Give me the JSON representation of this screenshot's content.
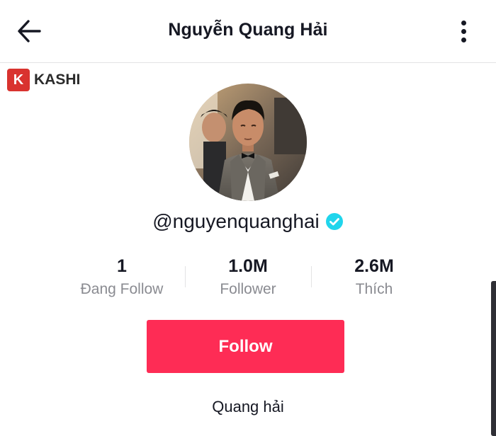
{
  "header": {
    "title": "Nguyễn Quang Hải",
    "back_icon": "arrow-left-icon",
    "more_icon": "more-vertical-icon"
  },
  "watermark": {
    "logo_letter": "K",
    "text": "KASHI"
  },
  "profile": {
    "username": "@nguyenquanghai",
    "verified": true,
    "bio": "Quang hải"
  },
  "stats": [
    {
      "value": "1",
      "label": "Đang Follow"
    },
    {
      "value": "1.0M",
      "label": "Follower"
    },
    {
      "value": "2.6M",
      "label": "Thích"
    }
  ],
  "actions": {
    "follow_label": "Follow"
  },
  "colors": {
    "accent": "#fe2c55",
    "verified": "#20d5ec",
    "watermark": "#d9332f",
    "muted_text": "#8a8b91"
  }
}
